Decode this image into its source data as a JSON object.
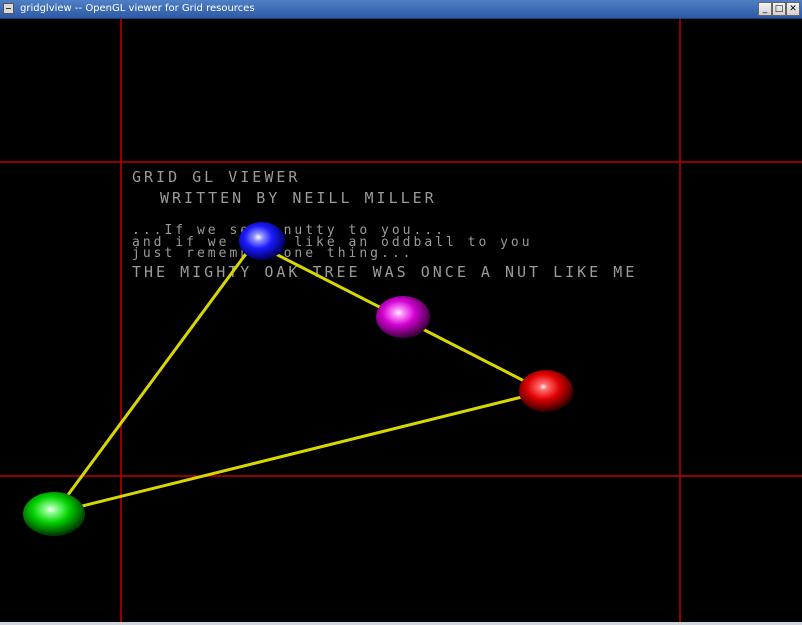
{
  "window": {
    "title": "gridglview -- OpenGL viewer for Grid resources",
    "buttons": {
      "minimize": "_",
      "maximize": "□",
      "close": "✕"
    }
  },
  "viewer": {
    "heading": "GRID GL VIEWER",
    "byline": "WRITTEN BY NEILL MILLER",
    "quote": [
      "...If we seem nutty to you...",
      "and if we seem like an oddball to you",
      "just remember one thing..."
    ],
    "motto": "THE MIGHTY OAK TREE WAS ONCE A NUT LIKE ME"
  },
  "scene": {
    "grid_color": "#c00000",
    "link_color": "#d8d800",
    "nodes": [
      {
        "name": "blue-node",
        "color": "#2020ff"
      },
      {
        "name": "magenta-node",
        "color": "#e000e0"
      },
      {
        "name": "red-node",
        "color": "#e00000"
      },
      {
        "name": "green-node",
        "color": "#00d000"
      }
    ]
  }
}
